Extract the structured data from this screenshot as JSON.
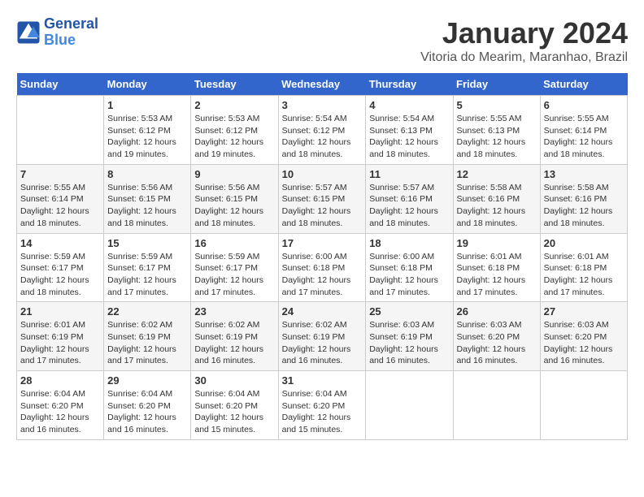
{
  "header": {
    "logo_line1": "General",
    "logo_line2": "Blue",
    "month": "January 2024",
    "location": "Vitoria do Mearim, Maranhao, Brazil"
  },
  "weekdays": [
    "Sunday",
    "Monday",
    "Tuesday",
    "Wednesday",
    "Thursday",
    "Friday",
    "Saturday"
  ],
  "weeks": [
    [
      {
        "day": "",
        "info": ""
      },
      {
        "day": "1",
        "info": "Sunrise: 5:53 AM\nSunset: 6:12 PM\nDaylight: 12 hours\nand 19 minutes."
      },
      {
        "day": "2",
        "info": "Sunrise: 5:53 AM\nSunset: 6:12 PM\nDaylight: 12 hours\nand 19 minutes."
      },
      {
        "day": "3",
        "info": "Sunrise: 5:54 AM\nSunset: 6:12 PM\nDaylight: 12 hours\nand 18 minutes."
      },
      {
        "day": "4",
        "info": "Sunrise: 5:54 AM\nSunset: 6:13 PM\nDaylight: 12 hours\nand 18 minutes."
      },
      {
        "day": "5",
        "info": "Sunrise: 5:55 AM\nSunset: 6:13 PM\nDaylight: 12 hours\nand 18 minutes."
      },
      {
        "day": "6",
        "info": "Sunrise: 5:55 AM\nSunset: 6:14 PM\nDaylight: 12 hours\nand 18 minutes."
      }
    ],
    [
      {
        "day": "7",
        "info": "Sunrise: 5:55 AM\nSunset: 6:14 PM\nDaylight: 12 hours\nand 18 minutes."
      },
      {
        "day": "8",
        "info": "Sunrise: 5:56 AM\nSunset: 6:15 PM\nDaylight: 12 hours\nand 18 minutes."
      },
      {
        "day": "9",
        "info": "Sunrise: 5:56 AM\nSunset: 6:15 PM\nDaylight: 12 hours\nand 18 minutes."
      },
      {
        "day": "10",
        "info": "Sunrise: 5:57 AM\nSunset: 6:15 PM\nDaylight: 12 hours\nand 18 minutes."
      },
      {
        "day": "11",
        "info": "Sunrise: 5:57 AM\nSunset: 6:16 PM\nDaylight: 12 hours\nand 18 minutes."
      },
      {
        "day": "12",
        "info": "Sunrise: 5:58 AM\nSunset: 6:16 PM\nDaylight: 12 hours\nand 18 minutes."
      },
      {
        "day": "13",
        "info": "Sunrise: 5:58 AM\nSunset: 6:16 PM\nDaylight: 12 hours\nand 18 minutes."
      }
    ],
    [
      {
        "day": "14",
        "info": "Sunrise: 5:59 AM\nSunset: 6:17 PM\nDaylight: 12 hours\nand 18 minutes."
      },
      {
        "day": "15",
        "info": "Sunrise: 5:59 AM\nSunset: 6:17 PM\nDaylight: 12 hours\nand 17 minutes."
      },
      {
        "day": "16",
        "info": "Sunrise: 5:59 AM\nSunset: 6:17 PM\nDaylight: 12 hours\nand 17 minutes."
      },
      {
        "day": "17",
        "info": "Sunrise: 6:00 AM\nSunset: 6:18 PM\nDaylight: 12 hours\nand 17 minutes."
      },
      {
        "day": "18",
        "info": "Sunrise: 6:00 AM\nSunset: 6:18 PM\nDaylight: 12 hours\nand 17 minutes."
      },
      {
        "day": "19",
        "info": "Sunrise: 6:01 AM\nSunset: 6:18 PM\nDaylight: 12 hours\nand 17 minutes."
      },
      {
        "day": "20",
        "info": "Sunrise: 6:01 AM\nSunset: 6:18 PM\nDaylight: 12 hours\nand 17 minutes."
      }
    ],
    [
      {
        "day": "21",
        "info": "Sunrise: 6:01 AM\nSunset: 6:19 PM\nDaylight: 12 hours\nand 17 minutes."
      },
      {
        "day": "22",
        "info": "Sunrise: 6:02 AM\nSunset: 6:19 PM\nDaylight: 12 hours\nand 17 minutes."
      },
      {
        "day": "23",
        "info": "Sunrise: 6:02 AM\nSunset: 6:19 PM\nDaylight: 12 hours\nand 16 minutes."
      },
      {
        "day": "24",
        "info": "Sunrise: 6:02 AM\nSunset: 6:19 PM\nDaylight: 12 hours\nand 16 minutes."
      },
      {
        "day": "25",
        "info": "Sunrise: 6:03 AM\nSunset: 6:19 PM\nDaylight: 12 hours\nand 16 minutes."
      },
      {
        "day": "26",
        "info": "Sunrise: 6:03 AM\nSunset: 6:20 PM\nDaylight: 12 hours\nand 16 minutes."
      },
      {
        "day": "27",
        "info": "Sunrise: 6:03 AM\nSunset: 6:20 PM\nDaylight: 12 hours\nand 16 minutes."
      }
    ],
    [
      {
        "day": "28",
        "info": "Sunrise: 6:04 AM\nSunset: 6:20 PM\nDaylight: 12 hours\nand 16 minutes."
      },
      {
        "day": "29",
        "info": "Sunrise: 6:04 AM\nSunset: 6:20 PM\nDaylight: 12 hours\nand 16 minutes."
      },
      {
        "day": "30",
        "info": "Sunrise: 6:04 AM\nSunset: 6:20 PM\nDaylight: 12 hours\nand 15 minutes."
      },
      {
        "day": "31",
        "info": "Sunrise: 6:04 AM\nSunset: 6:20 PM\nDaylight: 12 hours\nand 15 minutes."
      },
      {
        "day": "",
        "info": ""
      },
      {
        "day": "",
        "info": ""
      },
      {
        "day": "",
        "info": ""
      }
    ]
  ]
}
